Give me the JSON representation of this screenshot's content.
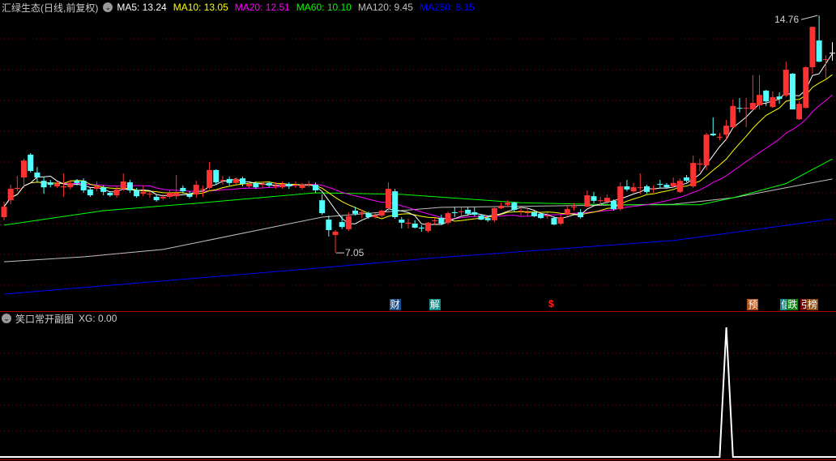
{
  "header": {
    "title": "汇绿生态(日线,前复权)",
    "ma_labels": [
      {
        "text": "MA5: 13.24",
        "color": "#ffffff"
      },
      {
        "text": "MA10: 13.05",
        "color": "#ffff00"
      },
      {
        "text": "MA20: 12.51",
        "color": "#ff00ff"
      },
      {
        "text": "MA60: 10.10",
        "color": "#00ff00"
      },
      {
        "text": "MA120: 9.45",
        "color": "#c0c0c0"
      },
      {
        "text": "MA250: 8.15",
        "color": "#0000ff"
      }
    ]
  },
  "sub_header": {
    "title": "笑口常开副图",
    "value": "XG: 0.00"
  },
  "markers": [
    {
      "label": "财",
      "index": 59,
      "bg": "#1c4e8c"
    },
    {
      "label": "解",
      "index": 65,
      "bg": "#178a8a"
    },
    {
      "label": "$",
      "index": 83,
      "bg": ""
    },
    {
      "label": "预",
      "index": 113,
      "bg": "#b4501a"
    },
    {
      "label": "信",
      "index": 118,
      "bg": "#178a8a"
    },
    {
      "label": "跌",
      "index": 119,
      "bg": "#148214"
    },
    {
      "label": "引",
      "index": 121,
      "bg": "#7a0a0a"
    },
    {
      "label": "榜",
      "index": 122,
      "bg": "#8c4a14"
    }
  ],
  "chart_data": {
    "type": "candlestick",
    "title": "汇绿生态(日线,前复权)",
    "ylim": [
      5.5,
      15.2
    ],
    "gridlines": [
      6,
      7,
      8,
      9,
      10,
      11,
      12,
      13,
      14
    ],
    "colors": {
      "up": "#ff3232",
      "down": "#54ffff",
      "flat": "#ffffff",
      "grid": "#8a0000"
    },
    "candles_ohlc": [
      [
        8.21,
        8.71,
        8.11,
        8.55
      ],
      [
        8.76,
        9.26,
        8.63,
        9.13
      ],
      [
        9.13,
        9.55,
        9.05,
        9.16
      ],
      [
        9.5,
        10.11,
        9.16,
        10.05
      ],
      [
        10.24,
        10.29,
        9.66,
        9.71
      ],
      [
        9.66,
        9.84,
        9.34,
        9.5
      ],
      [
        9.39,
        9.53,
        8.97,
        9.18
      ],
      [
        9.34,
        9.42,
        9.18,
        9.26
      ],
      [
        9.21,
        9.37,
        9.16,
        9.29
      ],
      [
        9.18,
        9.63,
        8.87,
        9.21
      ],
      [
        9.18,
        9.42,
        9.11,
        9.32
      ],
      [
        9.39,
        9.45,
        9.24,
        9.32
      ],
      [
        9.39,
        9.47,
        9.0,
        9.08
      ],
      [
        9.11,
        9.16,
        8.87,
        8.92
      ],
      [
        9.13,
        9.37,
        9.05,
        9.21
      ],
      [
        9.18,
        9.24,
        8.92,
        9.03
      ],
      [
        9.0,
        9.05,
        8.87,
        8.92
      ],
      [
        8.92,
        9.21,
        8.84,
        9.11
      ],
      [
        9.13,
        9.63,
        9.05,
        9.37
      ],
      [
        9.34,
        9.42,
        9.0,
        9.08
      ],
      [
        9.08,
        9.16,
        8.84,
        8.89
      ],
      [
        8.97,
        9.24,
        8.89,
        9.03
      ],
      [
        8.95,
        9.05,
        8.84,
        8.97
      ],
      [
        8.87,
        8.95,
        8.71,
        8.76
      ],
      [
        8.82,
        8.95,
        8.76,
        8.87
      ],
      [
        8.87,
        9.08,
        8.82,
        9.0
      ],
      [
        8.89,
        9.58,
        8.79,
        9.0
      ],
      [
        9.16,
        9.24,
        8.97,
        9.05
      ],
      [
        8.95,
        9.05,
        8.82,
        8.87
      ],
      [
        8.95,
        9.39,
        8.84,
        9.26
      ],
      [
        9.11,
        9.24,
        8.87,
        9.13
      ],
      [
        9.16,
        10.0,
        9.11,
        9.74
      ],
      [
        9.74,
        9.76,
        9.26,
        9.34
      ],
      [
        9.39,
        9.55,
        9.26,
        9.42
      ],
      [
        9.45,
        9.53,
        9.24,
        9.32
      ],
      [
        9.32,
        9.5,
        9.26,
        9.45
      ],
      [
        9.47,
        9.53,
        9.21,
        9.29
      ],
      [
        9.21,
        9.34,
        9.16,
        9.29
      ],
      [
        9.32,
        9.37,
        9.13,
        9.18
      ],
      [
        9.26,
        9.37,
        9.16,
        9.29
      ],
      [
        9.32,
        9.37,
        9.18,
        9.24
      ],
      [
        9.21,
        9.34,
        9.13,
        9.24
      ],
      [
        9.18,
        9.37,
        9.13,
        9.29
      ],
      [
        9.29,
        9.34,
        9.13,
        9.21
      ],
      [
        9.24,
        9.37,
        9.16,
        9.26
      ],
      [
        9.16,
        9.32,
        9.11,
        9.26
      ],
      [
        9.26,
        9.39,
        9.18,
        9.29
      ],
      [
        9.26,
        9.34,
        9.0,
        9.08
      ],
      [
        8.76,
        8.95,
        8.29,
        8.34
      ],
      [
        8.13,
        8.26,
        7.58,
        7.79
      ],
      [
        7.63,
        7.79,
        7.05,
        7.74
      ],
      [
        8.05,
        8.24,
        7.82,
        7.89
      ],
      [
        7.82,
        8.37,
        7.76,
        8.24
      ],
      [
        8.42,
        8.55,
        8.26,
        8.32
      ],
      [
        8.34,
        8.45,
        8.18,
        8.37
      ],
      [
        8.34,
        8.39,
        8.16,
        8.21
      ],
      [
        8.21,
        8.34,
        8.16,
        8.26
      ],
      [
        8.26,
        8.45,
        8.21,
        8.42
      ],
      [
        8.5,
        9.34,
        8.42,
        9.13
      ],
      [
        9.05,
        9.13,
        8.16,
        8.21
      ],
      [
        8.13,
        8.21,
        7.84,
        8.03
      ],
      [
        8.0,
        8.16,
        7.84,
        8.03
      ],
      [
        8.0,
        8.11,
        7.84,
        7.87
      ],
      [
        7.87,
        7.95,
        7.74,
        7.84
      ],
      [
        7.76,
        8.05,
        7.71,
        8.03
      ],
      [
        8.08,
        8.18,
        7.95,
        8.11
      ],
      [
        8.18,
        8.29,
        7.95,
        8.0
      ],
      [
        8.03,
        8.39,
        7.97,
        8.34
      ],
      [
        8.37,
        8.55,
        8.21,
        8.34
      ],
      [
        8.39,
        8.53,
        8.26,
        8.4
      ],
      [
        8.45,
        8.53,
        8.26,
        8.32
      ],
      [
        8.37,
        8.53,
        8.24,
        8.29
      ],
      [
        8.26,
        8.29,
        8.11,
        8.13
      ],
      [
        8.18,
        8.26,
        8.05,
        8.11
      ],
      [
        8.11,
        8.53,
        8.05,
        8.5
      ],
      [
        8.5,
        8.68,
        8.47,
        8.58
      ],
      [
        8.61,
        8.76,
        8.55,
        8.68
      ],
      [
        8.68,
        8.71,
        8.37,
        8.45
      ],
      [
        8.39,
        8.55,
        8.26,
        8.42
      ],
      [
        8.34,
        8.5,
        8.24,
        8.37
      ],
      [
        8.37,
        8.42,
        8.21,
        8.24
      ],
      [
        8.32,
        8.34,
        8.16,
        8.18
      ],
      [
        8.24,
        8.37,
        8.16,
        8.26
      ],
      [
        8.18,
        8.24,
        7.95,
        7.97
      ],
      [
        8.0,
        8.29,
        7.95,
        8.21
      ],
      [
        8.29,
        8.58,
        8.24,
        8.47
      ],
      [
        8.53,
        8.66,
        8.42,
        8.55
      ],
      [
        8.37,
        8.47,
        8.16,
        8.21
      ],
      [
        8.55,
        9.08,
        8.53,
        8.92
      ],
      [
        8.89,
        9.03,
        8.66,
        8.74
      ],
      [
        8.74,
        8.87,
        8.61,
        8.76
      ],
      [
        8.71,
        8.95,
        8.63,
        8.84
      ],
      [
        8.74,
        8.79,
        8.42,
        8.47
      ],
      [
        8.47,
        9.34,
        8.42,
        9.21
      ],
      [
        9.21,
        9.42,
        9.05,
        9.11
      ],
      [
        9.05,
        9.32,
        9.0,
        9.18
      ],
      [
        9.16,
        9.63,
        8.95,
        9.18
      ],
      [
        9.21,
        9.26,
        8.97,
        9.03
      ],
      [
        9.11,
        9.24,
        9.0,
        9.13
      ],
      [
        9.29,
        9.42,
        9.16,
        9.26
      ],
      [
        9.26,
        9.32,
        9.13,
        9.18
      ],
      [
        9.21,
        9.5,
        9.16,
        9.32
      ],
      [
        9.03,
        9.47,
        9.0,
        9.39
      ],
      [
        9.5,
        9.58,
        9.34,
        9.39
      ],
      [
        9.21,
        10.21,
        9.16,
        9.97
      ],
      [
        9.92,
        10.11,
        9.68,
        9.95
      ],
      [
        9.89,
        10.95,
        9.74,
        10.89
      ],
      [
        10.92,
        11.45,
        10.84,
        10.87
      ],
      [
        10.79,
        10.95,
        10.71,
        10.82
      ],
      [
        10.89,
        11.37,
        10.74,
        11.18
      ],
      [
        11.13,
        12.03,
        11.11,
        11.82
      ],
      [
        11.76,
        12.08,
        11.61,
        11.74
      ],
      [
        11.74,
        12.08,
        11.13,
        11.76
      ],
      [
        11.71,
        12.82,
        11.66,
        11.92
      ],
      [
        11.84,
        12.82,
        11.71,
        12.18
      ],
      [
        12.32,
        12.34,
        11.82,
        11.97
      ],
      [
        11.79,
        12.29,
        11.76,
        12.11
      ],
      [
        12.13,
        12.26,
        11.89,
        12.05
      ],
      [
        12.16,
        13.26,
        12.11,
        13.0
      ],
      [
        12.87,
        12.89,
        11.74,
        11.71
      ],
      [
        11.39,
        11.97,
        11.37,
        11.89
      ],
      [
        11.76,
        13.11,
        11.74,
        13.08
      ],
      [
        13.08,
        14.39,
        12.87,
        14.39
      ],
      [
        13.95,
        14.76,
        13.24,
        13.26
      ],
      [
        13.32,
        13.47,
        12.68,
        13.34
      ],
      [
        13.55,
        13.89,
        13.29,
        13.55
      ]
    ],
    "moving_averages": [
      {
        "name": "MA5",
        "period": 5,
        "color": "#ffffff"
      },
      {
        "name": "MA10",
        "period": 10,
        "color": "#ffff00"
      },
      {
        "name": "MA20",
        "period": 20,
        "color": "#ff00ff"
      },
      {
        "name": "MA60",
        "color": "#00ff00",
        "knots": [
          [
            0,
            7.95
          ],
          [
            15,
            8.42
          ],
          [
            30,
            8.68
          ],
          [
            47,
            9.0
          ],
          [
            60,
            8.95
          ],
          [
            78,
            8.68
          ],
          [
            92,
            8.61
          ],
          [
            105,
            8.61
          ],
          [
            110,
            8.84
          ],
          [
            118,
            9.3
          ],
          [
            125,
            10.1
          ]
        ]
      },
      {
        "name": "MA120",
        "color": "#c0c0c0",
        "knots": [
          [
            0,
            6.76
          ],
          [
            12,
            6.92
          ],
          [
            24,
            7.16
          ],
          [
            48,
            8.21
          ],
          [
            66,
            8.53
          ],
          [
            101,
            8.63
          ],
          [
            110,
            8.84
          ],
          [
            125,
            9.45
          ]
        ]
      },
      {
        "name": "MA250",
        "color": "#0000ff",
        "knots": [
          [
            0,
            5.71
          ],
          [
            47,
            6.55
          ],
          [
            64,
            6.87
          ],
          [
            101,
            7.45
          ],
          [
            125,
            8.15
          ]
        ]
      }
    ],
    "annotations": [
      {
        "text": "14.76",
        "index": 123,
        "value": 14.76,
        "kind": "high"
      },
      {
        "text": "7.05",
        "index": 50,
        "value": 7.05,
        "kind": "low"
      }
    ],
    "sub_chart": {
      "name": "XG",
      "ylim": [
        0,
        1.2
      ],
      "gridlines": [
        0.2,
        0.4,
        0.6,
        0.8
      ],
      "signals": [
        {
          "index": 109,
          "value": 1
        }
      ],
      "color": "#ffffff"
    }
  }
}
